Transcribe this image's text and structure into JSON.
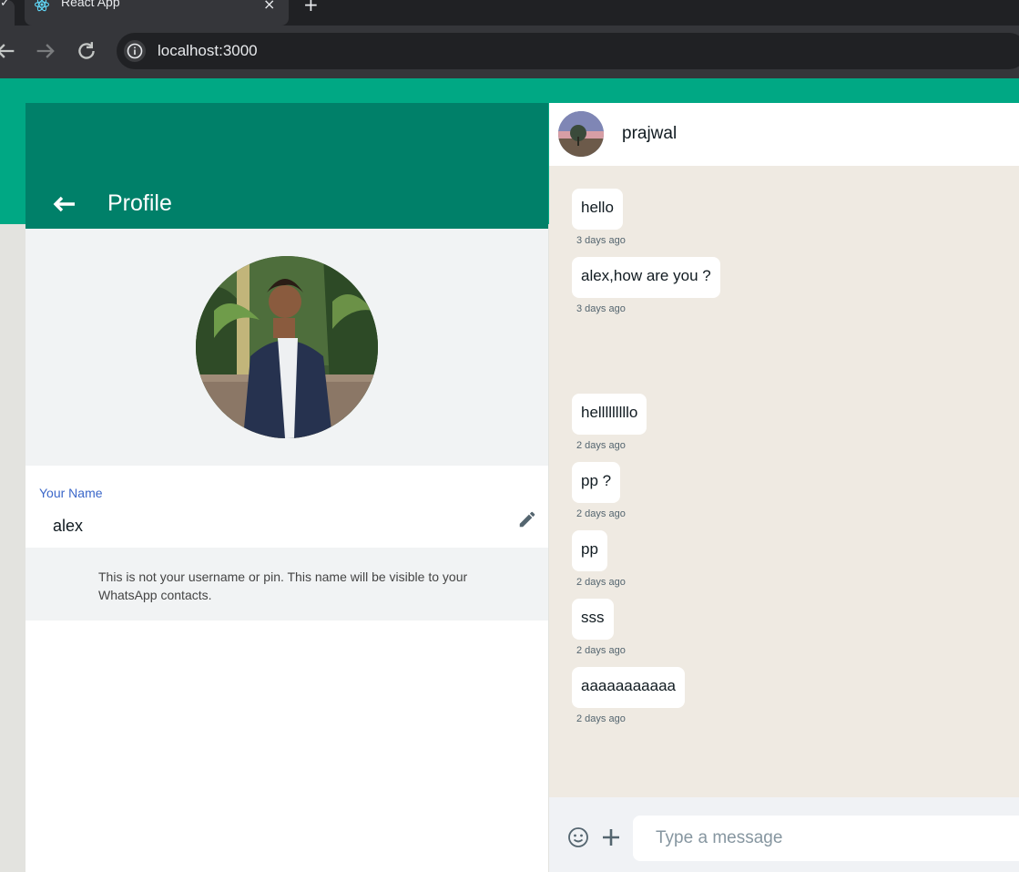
{
  "browser": {
    "tab_title": "React App",
    "tab_close": "×",
    "new_tab": "+",
    "left_stub": "✓",
    "url": "localhost:3000"
  },
  "profile": {
    "title": "Profile",
    "name_label": "Your Name",
    "name_value": "alex",
    "note": "This is not your username or pin. This name will be visible to your WhatsApp contacts."
  },
  "chat": {
    "contact_name": "prajwal",
    "input_placeholder": "Type a message",
    "messages": [
      {
        "text": "hello",
        "time": "3 days ago"
      },
      {
        "text": "alex,how are you ?",
        "time": "3 days ago"
      },
      {
        "text": "helllllllllo",
        "time": "2 days ago"
      },
      {
        "text": "pp ?",
        "time": "2 days ago"
      },
      {
        "text": "pp",
        "time": "2 days ago"
      },
      {
        "text": "sss",
        "time": "2 days ago"
      },
      {
        "text": "aaaaaaaaaaa",
        "time": "2 days ago"
      }
    ]
  },
  "colors": {
    "brand_green": "#00a884",
    "header_green": "#008069",
    "chat_background": "#efeae2",
    "label_blue": "#3b67c9"
  },
  "icons": {
    "back": "arrow-left-icon",
    "edit": "pencil-icon",
    "emoji": "smiley-icon",
    "attach": "plus-icon",
    "reload": "reload-icon",
    "info": "info-icon"
  }
}
